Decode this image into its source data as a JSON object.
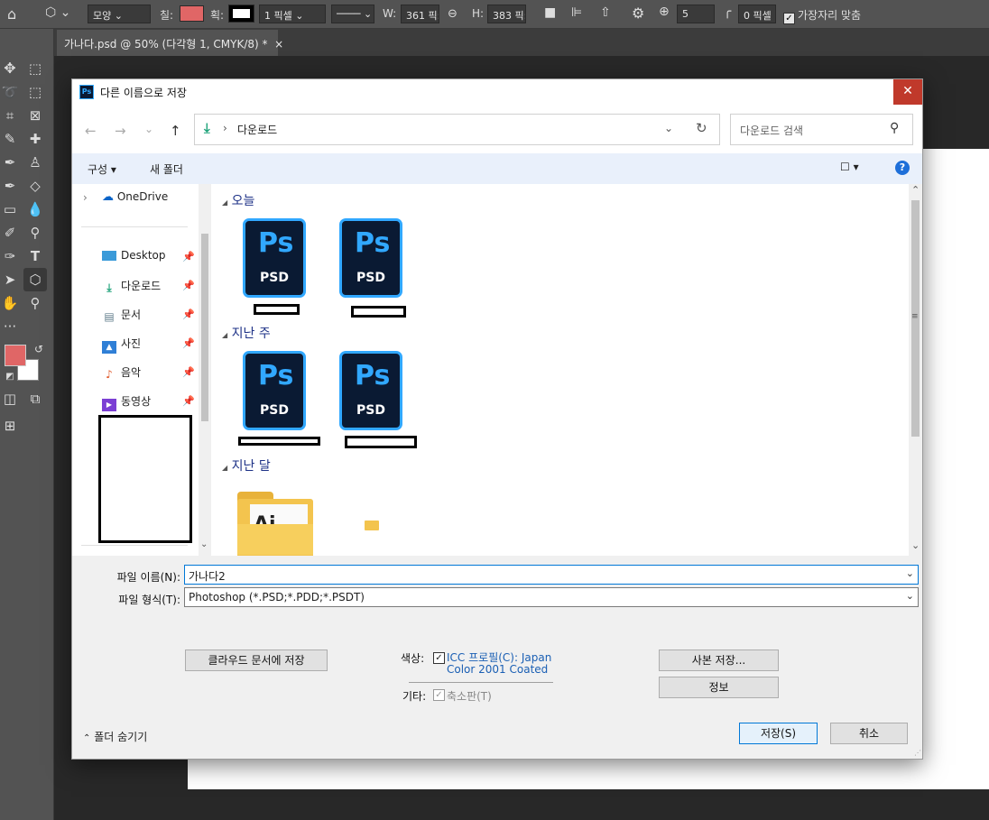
{
  "optbar": {
    "mode_label": "모양",
    "fill_label": "칠:",
    "fill_color": "#e06666",
    "stroke_label": "획:",
    "stroke_width": "1 픽셀",
    "w_label": "W:",
    "w_value": "361 픽:",
    "h_label": "H:",
    "h_value": "383 픽:",
    "sides_value": "5",
    "radius_value": "0 픽셀",
    "align_edges_label": "가장자리 맞춤"
  },
  "doc_tab": {
    "label": "가나다.psd @ 50% (다각형 1, CMYK/8) *",
    "close": "×"
  },
  "toolbar": {
    "foreground_color": "#e06666",
    "background_color": "#ffffff",
    "tools": [
      "move-tool",
      "marquee-tool",
      "lasso-tool",
      "object-select-tool",
      "crop-tool",
      "frame-tool",
      "eyedropper-tool",
      "healing-tool",
      "brush-tool",
      "stamp-tool",
      "history-brush-tool",
      "eraser-tool",
      "gradient-tool",
      "blur-tool",
      "dodge-tool",
      "pen-tool",
      "type-tool",
      "path-select-tool",
      "shape-tool",
      "hand-tool",
      "zoom-tool"
    ]
  },
  "dialog": {
    "title": "다른 이름으로 저장",
    "close": "✕",
    "nav": {
      "back": "←",
      "forward": "→",
      "recent": "⌄",
      "up": "↑"
    },
    "address": {
      "separator": "›",
      "path": "다운로드",
      "refresh": "↻"
    },
    "search": {
      "placeholder": "다운로드 검색"
    },
    "cmdbar": {
      "organize": "구성 ▾",
      "new_folder": "새 폴더",
      "view": "☐ ▾",
      "help": "?"
    },
    "sidebar": {
      "onedrive": "OneDrive",
      "items": [
        {
          "label": "Desktop",
          "icon": "desktop-icon"
        },
        {
          "label": "다운로드",
          "icon": "download-icon"
        },
        {
          "label": "문서",
          "icon": "document-icon"
        },
        {
          "label": "사진",
          "icon": "picture-icon"
        },
        {
          "label": "음악",
          "icon": "music-icon"
        },
        {
          "label": "동영상",
          "icon": "video-icon"
        }
      ]
    },
    "groups": [
      {
        "label": "오늘"
      },
      {
        "label": "지난 주"
      },
      {
        "label": "지난 달"
      }
    ],
    "file_icon": {
      "ps": "Ps",
      "ext": "PSD"
    },
    "folder_icon": {
      "text": "Ai"
    },
    "filename": {
      "label": "파일 이름(N):",
      "value": "가나다2"
    },
    "filetype": {
      "label": "파일 형식(T):",
      "value": "Photoshop (*.PSD;*.PDD;*.PSDT)"
    },
    "cloud_button": "클라우드 문서에 저장",
    "color": {
      "label": "색상:",
      "icc_line1": "ICC 프로필(C):  Japan",
      "icc_line2": "Color 2001 Coated"
    },
    "other": {
      "label": "기타:",
      "thumbnail": "축소판(T)"
    },
    "copy_button": "사본 저장...",
    "info_button": "정보",
    "hide_folders": "폴더 숨기기",
    "save_button": "저장(S)",
    "cancel_button": "취소"
  }
}
